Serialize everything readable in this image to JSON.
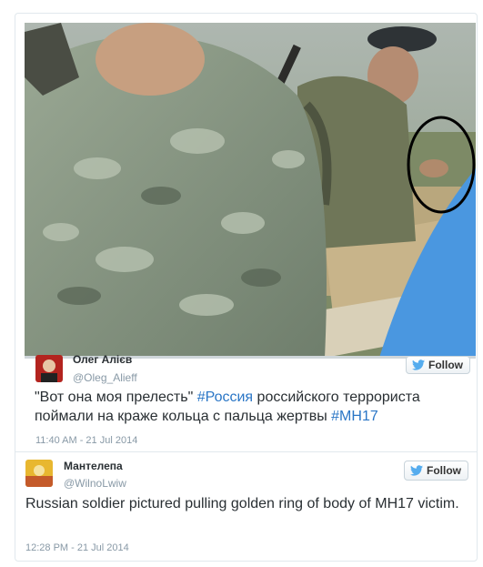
{
  "tweet1": {
    "name": "Олег Алієв",
    "handle": "@Oleg_Alieff",
    "follow_label": "Follow",
    "text_before": "\"Вот она моя прелесть\" ",
    "hashtag1": "#Россия",
    "text_middle": " российского террориста поймали на краже кольца с пальца жертвы ",
    "hashtag2": "#MH17",
    "timestamp": "11:40 AM - 21 Jul 2014"
  },
  "tweet2": {
    "name": "Мантелепа",
    "handle": "@WilnoLwiw",
    "follow_label": "Follow",
    "text": "Russian soldier pictured pulling golden ring of body of MH17 victim.",
    "timestamp": "12:28 PM - 21 Jul 2014"
  },
  "icons": {
    "follow": "twitter-bird-icon",
    "highlight": "black-circle-annotation"
  },
  "colors": {
    "hashtag": "#2a76c6",
    "handle": "#8899a6",
    "text": "#292f33",
    "bird": "#55acee"
  }
}
